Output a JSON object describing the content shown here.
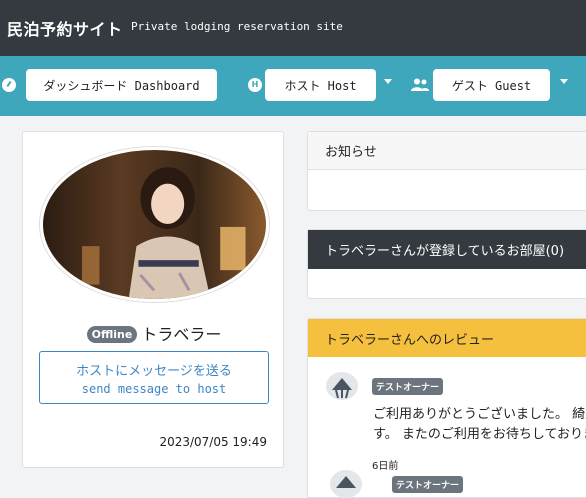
{
  "header": {
    "brand": "民泊予約サイト",
    "tagline": "Private lodging reservation site"
  },
  "nav": {
    "dashboard": "ダッシュボード Dashboard",
    "host": "ホスト Host",
    "host_icon_letter": "H",
    "guest": "ゲスト Guest"
  },
  "profile": {
    "status": "Offline",
    "name": "トラベラー",
    "message_jp": "ホストにメッセージを送る",
    "message_en": "send message to host",
    "date": "2023/07/05 19:49"
  },
  "panels": {
    "notice_title": "お知らせ",
    "rooms_title": "トラベラーさんが登録しているお部屋(0)",
    "reviews_title": "トラベラーさんへのレビュー"
  },
  "reviews": [
    {
      "reviewer": "テストオーナー",
      "text_line1": "ご利用ありがとうございました。 綺麗",
      "text_line2": "す。 またのご利用をお待ちしております"
    },
    {
      "reviewer": "テストオーナー",
      "time": "6日前"
    }
  ],
  "colors": {
    "topbar": "#343a40",
    "navbar": "#3fa7bc",
    "review_header": "#f6c03f",
    "offline_badge": "#6c757d",
    "message_button": "#3c86c6"
  }
}
